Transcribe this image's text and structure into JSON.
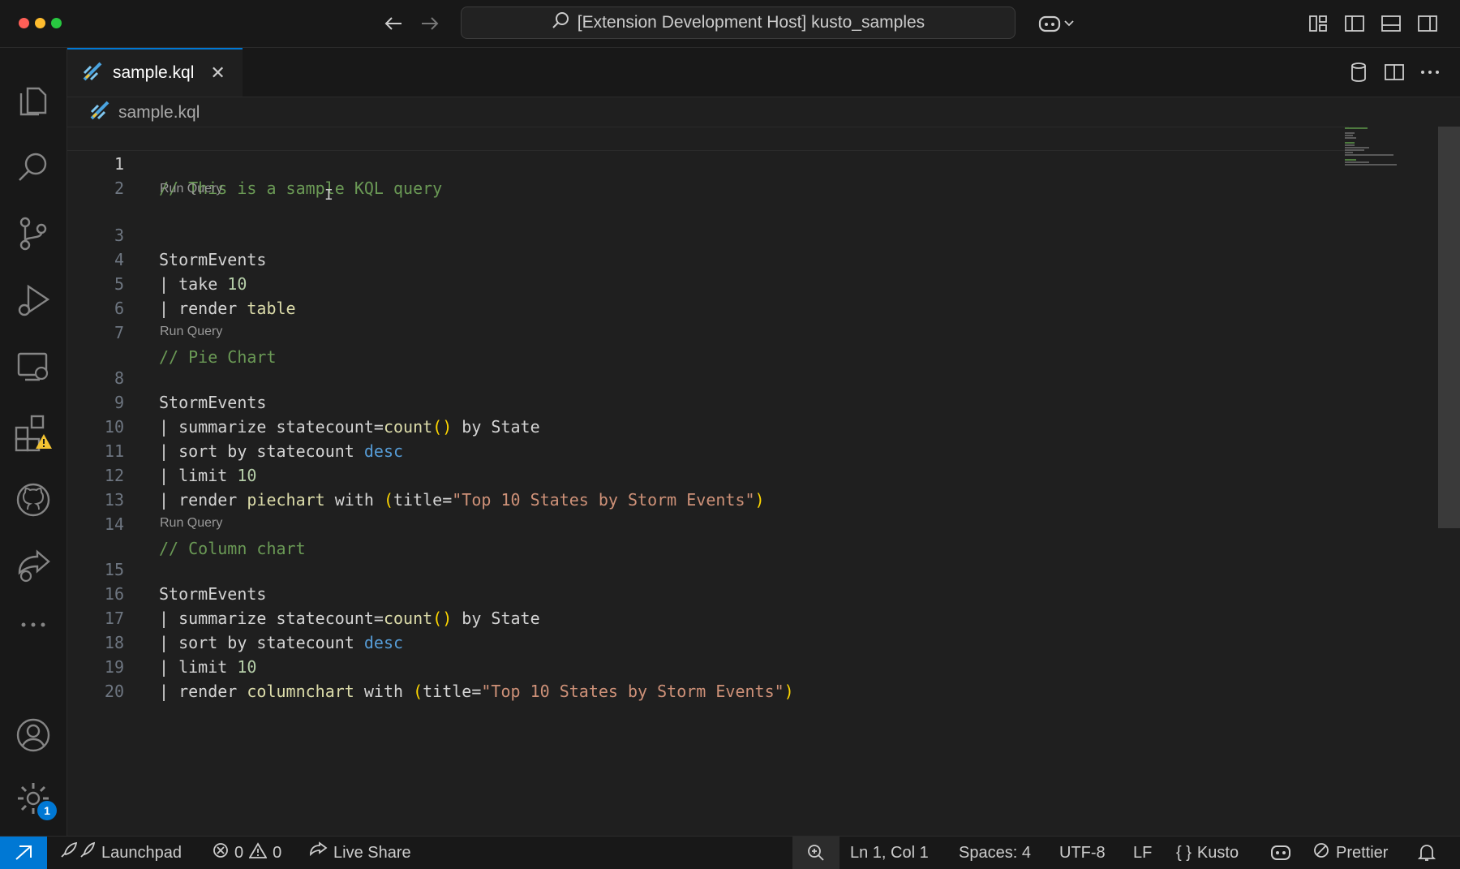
{
  "window": {
    "title": "[Extension Development Host] kusto_samples"
  },
  "tab": {
    "label": "sample.kql",
    "close_symbol": "✕"
  },
  "breadcrumb": {
    "file": "sample.kql"
  },
  "codelens": {
    "run_query": "Run Query"
  },
  "editor": {
    "line_numbers": [
      "1",
      "2",
      "3",
      "4",
      "5",
      "6",
      "7",
      "8",
      "9",
      "10",
      "11",
      "12",
      "13",
      "14",
      "15",
      "16",
      "17",
      "18",
      "19",
      "20"
    ],
    "lines": {
      "l1": "// This is a sample KQL query",
      "l3": "StormEvents",
      "l4_pipe": "| take ",
      "l4_num": "10",
      "l5_pipe": "| render ",
      "l5_fn": "table",
      "l7": "// Pie Chart",
      "l8": "StormEvents",
      "l9_a": "| summarize statecount=",
      "l9_fn": "count",
      "l9_paren": "()",
      "l9_b": " by State",
      "l10_a": "| sort by statecount ",
      "l10_kw": "desc",
      "l11_a": "| limit ",
      "l11_num": "10",
      "l12_a": "| render ",
      "l12_fn": "piechart",
      "l12_b": " with ",
      "l12_open": "(",
      "l12_c": "title=",
      "l12_str": "\"Top 10 States by Storm Events\"",
      "l12_close": ")",
      "l14": "// Column chart",
      "l15": "StormEvents",
      "l16_a": "| summarize statecount=",
      "l16_fn": "count",
      "l16_paren": "()",
      "l16_b": " by State",
      "l17_a": "| sort by statecount ",
      "l17_kw": "desc",
      "l18_a": "| limit ",
      "l18_num": "10",
      "l19_a": "| render ",
      "l19_fn": "columnchart",
      "l19_b": " with ",
      "l19_open": "(",
      "l19_c": "title=",
      "l19_str": "\"Top 10 States by Storm Events\"",
      "l19_close": ")"
    }
  },
  "activity_bar": {
    "settings_badge": "1"
  },
  "statusbar": {
    "launchpad": "Launchpad",
    "errors": "0",
    "warnings": "0",
    "live_share": "Live Share",
    "position": "Ln 1, Col 1",
    "spaces": "Spaces: 4",
    "encoding": "UTF-8",
    "eol": "LF",
    "language_braces": "{ }",
    "language": "Kusto",
    "prettier": "Prettier"
  },
  "colors": {
    "accent": "#0078d4",
    "comment": "#6a9955",
    "string": "#ce9178",
    "keyword": "#569cd6",
    "number": "#b5cea8",
    "warning_badge": "#f1c232"
  },
  "icons": [
    "explorer-icon",
    "search-icon",
    "source-control-icon",
    "run-debug-icon",
    "remote-explorer-icon",
    "extensions-icon",
    "github-icon",
    "live-share-icon",
    "more-icon",
    "account-icon",
    "settings-gear-icon"
  ]
}
